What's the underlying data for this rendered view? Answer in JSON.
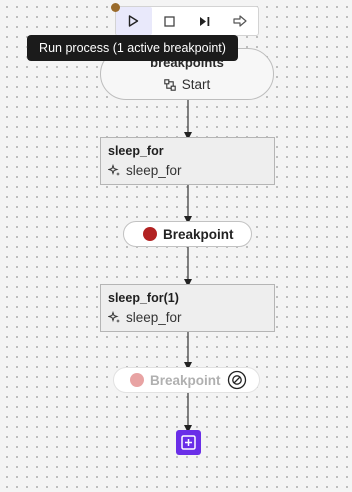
{
  "toolbar": {
    "buttons": [
      {
        "name": "run",
        "icon": "play-icon",
        "active": true
      },
      {
        "name": "stop",
        "icon": "stop-icon",
        "active": false
      },
      {
        "name": "step",
        "icon": "step-forward-icon",
        "active": false
      },
      {
        "name": "continue",
        "icon": "arrow-right-icon",
        "active": false
      }
    ],
    "status_dot_color": "#9a6b2c"
  },
  "tooltip": {
    "text": "Run process (1 active breakpoint)"
  },
  "start_node": {
    "title": "breakpoints",
    "label": "Start",
    "icon": "flow-icon"
  },
  "steps": [
    {
      "title": "sleep_for",
      "action_label": "sleep_for",
      "icon": "sparkle-icon"
    },
    {
      "title": "sleep_for(1)",
      "action_label": "sleep_for",
      "icon": "sparkle-icon"
    }
  ],
  "breakpoints": [
    {
      "label": "Breakpoint",
      "state": "active",
      "dot_color": "#b22222"
    },
    {
      "label": "Breakpoint",
      "state": "disabled",
      "dot_color": "#e8a3a3",
      "icon": "disabled-circle-icon"
    }
  ],
  "add_button": {
    "icon": "plus-square-icon",
    "color": "#6a2ee8"
  }
}
